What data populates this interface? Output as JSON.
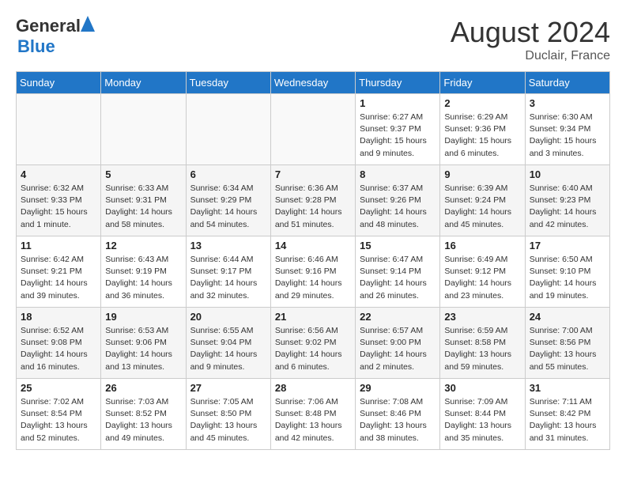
{
  "header": {
    "logo_general": "General",
    "logo_blue": "Blue",
    "month_year": "August 2024",
    "location": "Duclair, France"
  },
  "days_of_week": [
    "Sunday",
    "Monday",
    "Tuesday",
    "Wednesday",
    "Thursday",
    "Friday",
    "Saturday"
  ],
  "weeks": [
    [
      {
        "day": "",
        "info": ""
      },
      {
        "day": "",
        "info": ""
      },
      {
        "day": "",
        "info": ""
      },
      {
        "day": "",
        "info": ""
      },
      {
        "day": "1",
        "info": "Sunrise: 6:27 AM\nSunset: 9:37 PM\nDaylight: 15 hours\nand 9 minutes."
      },
      {
        "day": "2",
        "info": "Sunrise: 6:29 AM\nSunset: 9:36 PM\nDaylight: 15 hours\nand 6 minutes."
      },
      {
        "day": "3",
        "info": "Sunrise: 6:30 AM\nSunset: 9:34 PM\nDaylight: 15 hours\nand 3 minutes."
      }
    ],
    [
      {
        "day": "4",
        "info": "Sunrise: 6:32 AM\nSunset: 9:33 PM\nDaylight: 15 hours\nand 1 minute."
      },
      {
        "day": "5",
        "info": "Sunrise: 6:33 AM\nSunset: 9:31 PM\nDaylight: 14 hours\nand 58 minutes."
      },
      {
        "day": "6",
        "info": "Sunrise: 6:34 AM\nSunset: 9:29 PM\nDaylight: 14 hours\nand 54 minutes."
      },
      {
        "day": "7",
        "info": "Sunrise: 6:36 AM\nSunset: 9:28 PM\nDaylight: 14 hours\nand 51 minutes."
      },
      {
        "day": "8",
        "info": "Sunrise: 6:37 AM\nSunset: 9:26 PM\nDaylight: 14 hours\nand 48 minutes."
      },
      {
        "day": "9",
        "info": "Sunrise: 6:39 AM\nSunset: 9:24 PM\nDaylight: 14 hours\nand 45 minutes."
      },
      {
        "day": "10",
        "info": "Sunrise: 6:40 AM\nSunset: 9:23 PM\nDaylight: 14 hours\nand 42 minutes."
      }
    ],
    [
      {
        "day": "11",
        "info": "Sunrise: 6:42 AM\nSunset: 9:21 PM\nDaylight: 14 hours\nand 39 minutes."
      },
      {
        "day": "12",
        "info": "Sunrise: 6:43 AM\nSunset: 9:19 PM\nDaylight: 14 hours\nand 36 minutes."
      },
      {
        "day": "13",
        "info": "Sunrise: 6:44 AM\nSunset: 9:17 PM\nDaylight: 14 hours\nand 32 minutes."
      },
      {
        "day": "14",
        "info": "Sunrise: 6:46 AM\nSunset: 9:16 PM\nDaylight: 14 hours\nand 29 minutes."
      },
      {
        "day": "15",
        "info": "Sunrise: 6:47 AM\nSunset: 9:14 PM\nDaylight: 14 hours\nand 26 minutes."
      },
      {
        "day": "16",
        "info": "Sunrise: 6:49 AM\nSunset: 9:12 PM\nDaylight: 14 hours\nand 23 minutes."
      },
      {
        "day": "17",
        "info": "Sunrise: 6:50 AM\nSunset: 9:10 PM\nDaylight: 14 hours\nand 19 minutes."
      }
    ],
    [
      {
        "day": "18",
        "info": "Sunrise: 6:52 AM\nSunset: 9:08 PM\nDaylight: 14 hours\nand 16 minutes."
      },
      {
        "day": "19",
        "info": "Sunrise: 6:53 AM\nSunset: 9:06 PM\nDaylight: 14 hours\nand 13 minutes."
      },
      {
        "day": "20",
        "info": "Sunrise: 6:55 AM\nSunset: 9:04 PM\nDaylight: 14 hours\nand 9 minutes."
      },
      {
        "day": "21",
        "info": "Sunrise: 6:56 AM\nSunset: 9:02 PM\nDaylight: 14 hours\nand 6 minutes."
      },
      {
        "day": "22",
        "info": "Sunrise: 6:57 AM\nSunset: 9:00 PM\nDaylight: 14 hours\nand 2 minutes."
      },
      {
        "day": "23",
        "info": "Sunrise: 6:59 AM\nSunset: 8:58 PM\nDaylight: 13 hours\nand 59 minutes."
      },
      {
        "day": "24",
        "info": "Sunrise: 7:00 AM\nSunset: 8:56 PM\nDaylight: 13 hours\nand 55 minutes."
      }
    ],
    [
      {
        "day": "25",
        "info": "Sunrise: 7:02 AM\nSunset: 8:54 PM\nDaylight: 13 hours\nand 52 minutes."
      },
      {
        "day": "26",
        "info": "Sunrise: 7:03 AM\nSunset: 8:52 PM\nDaylight: 13 hours\nand 49 minutes."
      },
      {
        "day": "27",
        "info": "Sunrise: 7:05 AM\nSunset: 8:50 PM\nDaylight: 13 hours\nand 45 minutes."
      },
      {
        "day": "28",
        "info": "Sunrise: 7:06 AM\nSunset: 8:48 PM\nDaylight: 13 hours\nand 42 minutes."
      },
      {
        "day": "29",
        "info": "Sunrise: 7:08 AM\nSunset: 8:46 PM\nDaylight: 13 hours\nand 38 minutes."
      },
      {
        "day": "30",
        "info": "Sunrise: 7:09 AM\nSunset: 8:44 PM\nDaylight: 13 hours\nand 35 minutes."
      },
      {
        "day": "31",
        "info": "Sunrise: 7:11 AM\nSunset: 8:42 PM\nDaylight: 13 hours\nand 31 minutes."
      }
    ]
  ]
}
